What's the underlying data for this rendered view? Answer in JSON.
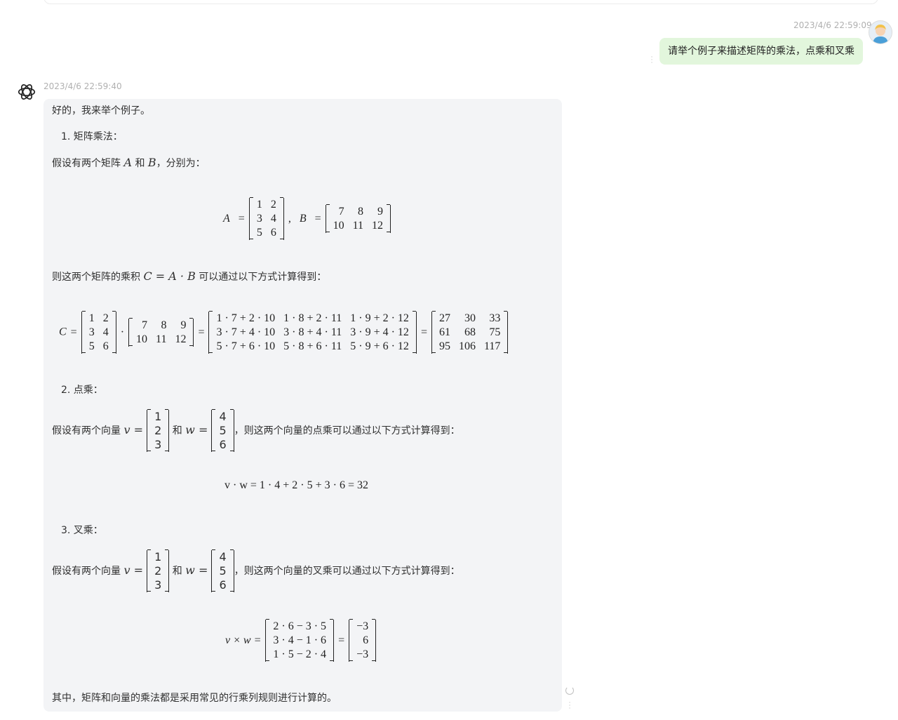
{
  "user_message": {
    "timestamp": "2023/4/6 22:59:09",
    "text": "请举个例子来描述矩阵的乘法，点乘和叉乘"
  },
  "bot_message": {
    "timestamp": "2023/4/6 22:59:40",
    "intro": "好的，我来举个例子。",
    "section1_title": "1. 矩阵乘法：",
    "section1_text_a": "假设有两个矩阵",
    "section1_text_and": "和",
    "section1_text_b": "，分别为：",
    "section1_text2_a": "则这两个矩阵的乘积",
    "section1_text2_b": "可以通过以下方式计算得到：",
    "section2_title": "2. 点乘：",
    "section2_text_a": "假设有两个向量",
    "section2_text_and": "和",
    "section2_text_b": "，则这两个向量的点乘可以通过以下方式计算得到：",
    "section3_title": "3. 叉乘：",
    "section3_text_a": "假设有两个向量",
    "section3_text_and": "和",
    "section3_text_b": "，则这两个向量的叉乘可以通过以下方式计算得到：",
    "conclusion": "其中，矩阵和向量的乘法都是采用常见的行乘列规则进行计算的。"
  },
  "math": {
    "var_A": "A",
    "var_B": "B",
    "var_C": "C",
    "var_v": "v",
    "var_w": "w",
    "matrix_A": [
      [
        "1",
        "2"
      ],
      [
        "3",
        "4"
      ],
      [
        "5",
        "6"
      ]
    ],
    "matrix_B": [
      [
        "7",
        "8",
        "9"
      ],
      [
        "10",
        "11",
        "12"
      ]
    ],
    "matrix_expanded": [
      [
        "1 · 7 + 2 · 10",
        "1 · 8 + 2 · 11",
        "1 · 9 + 2 · 12"
      ],
      [
        "3 · 7 + 4 · 10",
        "3 · 8 + 4 · 11",
        "3 · 9 + 4 · 12"
      ],
      [
        "5 · 7 + 6 · 10",
        "5 · 8 + 6 · 11",
        "5 · 9 + 6 · 12"
      ]
    ],
    "matrix_C": [
      [
        "27",
        "30",
        "33"
      ],
      [
        "61",
        "68",
        "75"
      ],
      [
        "95",
        "106",
        "117"
      ]
    ],
    "vector_v": [
      "1",
      "2",
      "3"
    ],
    "vector_w": [
      "4",
      "5",
      "6"
    ],
    "dot_expr": "v · w = 1 · 4 + 2 · 5 + 3 · 6 = 32",
    "cross_expanded": [
      "2 · 6 − 3 · 5",
      "3 · 4 − 1 · 6",
      "1 · 5 − 2 · 4"
    ],
    "cross_result": [
      "−3",
      "6",
      "−3"
    ],
    "cross_lhs": "v × w =",
    "C_def": "C = A · B"
  }
}
